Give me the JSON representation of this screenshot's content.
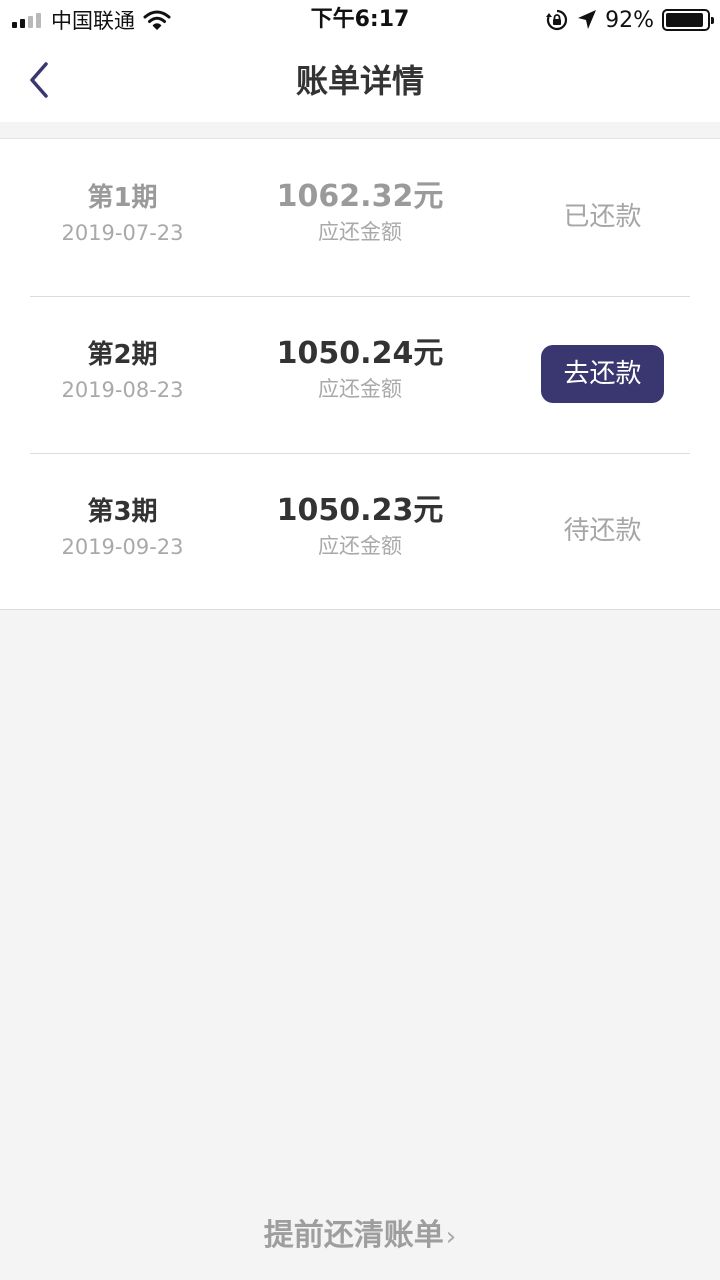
{
  "status_bar": {
    "carrier": "中国联通",
    "time": "下午6:17",
    "battery_percent": "92%",
    "battery_level": 0.92,
    "icons": [
      "signal-icon",
      "wifi-icon",
      "rotation-lock-icon",
      "location-icon",
      "battery-icon"
    ]
  },
  "nav": {
    "title": "账单详情",
    "back_icon": "chevron-left-icon",
    "accent": "#3a3770"
  },
  "bills": [
    {
      "period": "第1期",
      "date": "2019-07-23",
      "amount": "1062.32元",
      "amount_label": "应还金额",
      "status": "已还款",
      "state": "paid"
    },
    {
      "period": "第2期",
      "date": "2019-08-23",
      "amount": "1050.24元",
      "amount_label": "应还金额",
      "status": "去还款",
      "state": "active"
    },
    {
      "period": "第3期",
      "date": "2019-09-23",
      "amount": "1050.23元",
      "amount_label": "应还金额",
      "status": "待还款",
      "state": "pending"
    }
  ],
  "footer": {
    "link_label": "提前还清账单",
    "chevron": "›"
  }
}
